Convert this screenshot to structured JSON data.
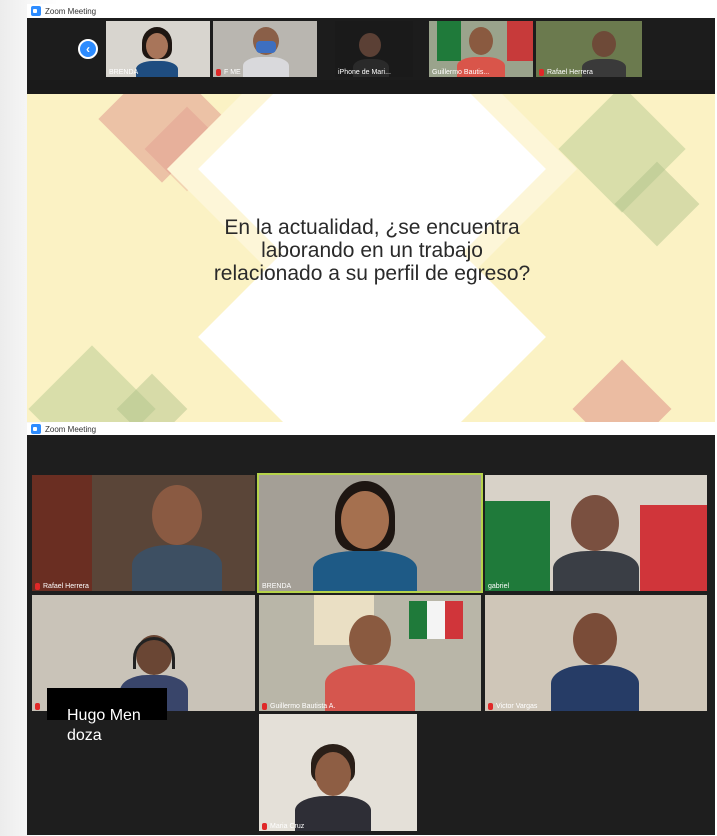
{
  "window1": {
    "title": "Zoom Meeting",
    "thumbnails": [
      {
        "name": "BRENDA",
        "muted": false
      },
      {
        "name": "F ME",
        "muted": true
      },
      {
        "name": "iPhone de Mari...",
        "muted": false
      },
      {
        "name": "Guillermo Bautis...",
        "muted": false
      },
      {
        "name": "Rafael Herrera",
        "muted": true
      }
    ],
    "slide_text": "En la actualidad, ¿se encuentra laborando en un trabajo relacionado a su perfil de egreso?"
  },
  "window2": {
    "title": "Zoom Meeting",
    "tiles": [
      {
        "name": "Rafael Herrera",
        "muted": true
      },
      {
        "name": "BRENDA",
        "muted": false,
        "active_speaker": true
      },
      {
        "name": "gabriel",
        "muted": false
      },
      {
        "name": "",
        "muted": true
      },
      {
        "name": "Guillermo Bautista A.",
        "muted": true
      },
      {
        "name": "Victor Vargas",
        "muted": true
      },
      {
        "name": "Maria Cruz",
        "muted": true
      }
    ]
  },
  "overlay_name": "Hugo Mendoza",
  "colors": {
    "zoom_blue": "#2d8cff",
    "mute_red": "#e02828",
    "speaker_highlight": "#b6d34a",
    "slide_background": "#fbf2c4"
  }
}
